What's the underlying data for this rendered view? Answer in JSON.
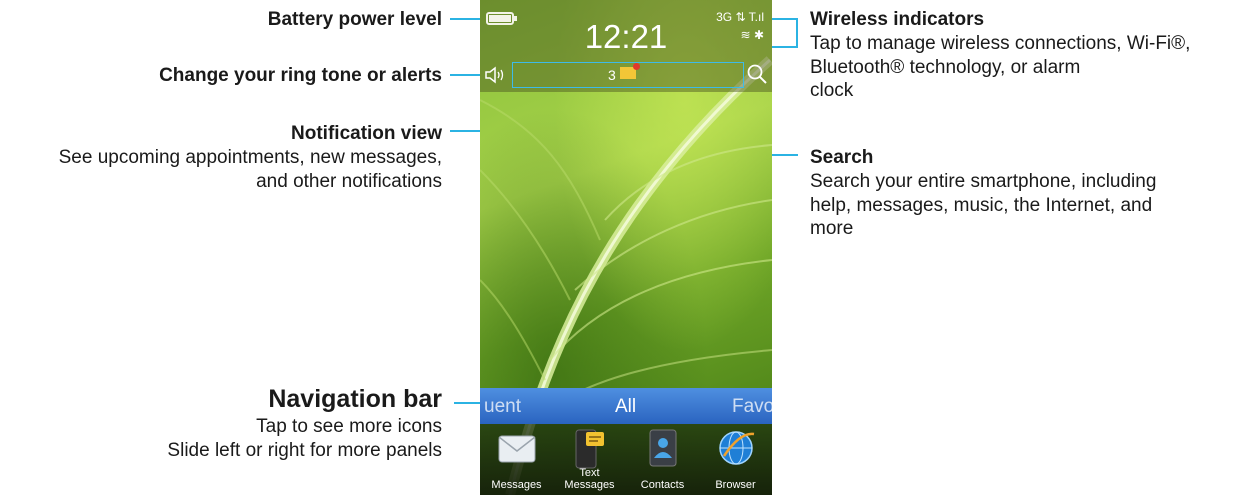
{
  "callouts": {
    "battery": {
      "title": "Battery power level"
    },
    "ring": {
      "title": "Change your ring tone or alerts"
    },
    "notification": {
      "title": "Notification view",
      "desc_1": "See upcoming appointments, new messages,",
      "desc_2": "and other notifications"
    },
    "navigation": {
      "title": "Navigation bar",
      "desc_1": "Tap to see more icons",
      "desc_2": "Slide left or right for more panels"
    },
    "wireless": {
      "title": "Wireless indicators",
      "desc_1": "Tap to manage wireless connections, Wi-Fi®,",
      "desc_2": "Bluetooth® technology, or alarm",
      "desc_3": "clock"
    },
    "search": {
      "title": "Search",
      "desc_1": "Search your entire smartphone, including",
      "desc_2": "help, messages, music, the Internet, and",
      "desc_3": "more"
    }
  },
  "phone": {
    "time": "12:21",
    "network": "3G",
    "notification_count": "3",
    "battery_level": 1.0,
    "nav_tabs": {
      "left": "uent",
      "center": "All",
      "right": "Favo"
    },
    "apps": [
      {
        "label": "Messages",
        "icon": "envelope-icon"
      },
      {
        "label": "Text Messages",
        "icon": "text-messages-icon"
      },
      {
        "label": "Contacts",
        "icon": "contacts-icon"
      },
      {
        "label": "Browser",
        "icon": "globe-icon"
      }
    ]
  },
  "colors": {
    "callout_line": "#2bb3e3",
    "nav_bar": "#2a64c0"
  }
}
